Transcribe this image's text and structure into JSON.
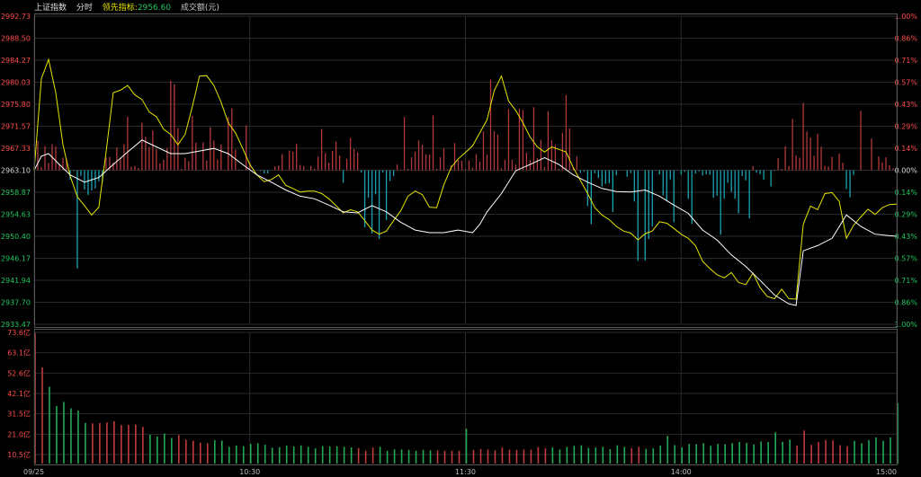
{
  "header": {
    "index_name": "上证指数",
    "mode": "分时",
    "leading_label": "领先指标:",
    "leading_value": "2956.60",
    "volume_label": "成交额(元)"
  },
  "colors": {
    "background": "#000000",
    "grid": "#2a2a2a",
    "frame": "#555555",
    "up": "#ff4d4d",
    "down": "#22c55e",
    "neutral": "#d9d9d9",
    "price_line": "#ffffff",
    "leading_line": "#e6e600",
    "pos_bar": "#b03a3a",
    "neg_bar": "#1ba3b3",
    "vol_up": "#c23b3b",
    "vol_down": "#22aa55",
    "header_text": "#e0e0e0",
    "header_value": "#22c55e"
  },
  "chart_data": [
    {
      "type": "line",
      "panel": "price",
      "preclose": 2963.1,
      "ylim": [
        2933.47,
        2992.73
      ],
      "y_ticks_left": [
        "2992.73",
        "2988.50",
        "2984.27",
        "2980.03",
        "2975.80",
        "2971.57",
        "2967.33",
        "2963.10",
        "2958.87",
        "2954.63",
        "2950.40",
        "2946.17",
        "2941.94",
        "2937.70",
        "2933.47"
      ],
      "y_ticks_right": [
        "1.00%",
        "0.86%",
        "0.71%",
        "0.57%",
        "0.43%",
        "0.29%",
        "0.14%",
        "0.00%",
        "0.14%",
        "0.29%",
        "0.43%",
        "0.57%",
        "0.71%",
        "0.86%",
        "1.00%"
      ],
      "x_ticks": [
        "09/25",
        "10:30",
        "11:30",
        "14:00",
        "15:00"
      ],
      "minutes_total": 240,
      "series": [
        {
          "key": "price",
          "points": [
            [
              0,
              2963.1
            ],
            [
              2,
              2965.8
            ],
            [
              4,
              2966.3
            ],
            [
              7,
              2964.2
            ],
            [
              10,
              2962.2
            ],
            [
              14,
              2960.8
            ],
            [
              18,
              2961.7
            ],
            [
              22,
              2964.2
            ],
            [
              26,
              2966.6
            ],
            [
              30,
              2968.9
            ],
            [
              34,
              2967.6
            ],
            [
              38,
              2966.3
            ],
            [
              42,
              2966.3
            ],
            [
              46,
              2966.8
            ],
            [
              50,
              2967.3
            ],
            [
              54,
              2966.3
            ],
            [
              58,
              2964.2
            ],
            [
              62,
              2962.2
            ],
            [
              66,
              2960.8
            ],
            [
              70,
              2959.3
            ],
            [
              74,
              2958.1
            ],
            [
              78,
              2957.6
            ],
            [
              82,
              2956.4
            ],
            [
              86,
              2955.1
            ],
            [
              90,
              2954.9
            ],
            [
              94,
              2956.3
            ],
            [
              98,
              2955.1
            ],
            [
              102,
              2953.1
            ],
            [
              106,
              2951.6
            ],
            [
              110,
              2951.1
            ],
            [
              114,
              2951.1
            ],
            [
              118,
              2951.6
            ],
            [
              122,
              2951.1
            ],
            [
              124,
              2952.7
            ],
            [
              126,
              2955.1
            ],
            [
              130,
              2958.6
            ],
            [
              134,
              2963.0
            ],
            [
              138,
              2964.2
            ],
            [
              142,
              2965.5
            ],
            [
              146,
              2964.2
            ],
            [
              150,
              2962.2
            ],
            [
              154,
              2960.8
            ],
            [
              158,
              2959.6
            ],
            [
              162,
              2959.0
            ],
            [
              166,
              2958.9
            ],
            [
              170,
              2959.3
            ],
            [
              174,
              2958.1
            ],
            [
              178,
              2956.4
            ],
            [
              182,
              2954.8
            ],
            [
              186,
              2951.6
            ],
            [
              190,
              2949.7
            ],
            [
              194,
              2946.8
            ],
            [
              198,
              2944.6
            ],
            [
              202,
              2941.9
            ],
            [
              206,
              2939.1
            ],
            [
              210,
              2937.4
            ],
            [
              212,
              2937.1
            ],
            [
              214,
              2947.6
            ],
            [
              218,
              2948.6
            ],
            [
              222,
              2950.0
            ],
            [
              226,
              2954.5
            ],
            [
              230,
              2952.3
            ],
            [
              234,
              2950.8
            ],
            [
              238,
              2950.5
            ],
            [
              240,
              2950.4
            ]
          ]
        },
        {
          "key": "leading",
          "points": [
            [
              0,
              2963.1
            ],
            [
              2,
              2980.7
            ],
            [
              4,
              2984.4
            ],
            [
              6,
              2978.0
            ],
            [
              8,
              2968.0
            ],
            [
              10,
              2962.0
            ],
            [
              12,
              2958.0
            ],
            [
              14,
              2956.3
            ],
            [
              16,
              2954.5
            ],
            [
              18,
              2956.0
            ],
            [
              20,
              2966.5
            ],
            [
              22,
              2978.0
            ],
            [
              24,
              2978.5
            ],
            [
              26,
              2979.4
            ],
            [
              28,
              2977.6
            ],
            [
              30,
              2976.7
            ],
            [
              32,
              2974.3
            ],
            [
              34,
              2973.4
            ],
            [
              36,
              2971.0
            ],
            [
              38,
              2970.0
            ],
            [
              40,
              2968.0
            ],
            [
              42,
              2970.0
            ],
            [
              44,
              2975.3
            ],
            [
              46,
              2981.2
            ],
            [
              48,
              2981.3
            ],
            [
              50,
              2979.4
            ],
            [
              52,
              2976.2
            ],
            [
              54,
              2972.2
            ],
            [
              56,
              2970.3
            ],
            [
              58,
              2967.3
            ],
            [
              60,
              2964.2
            ],
            [
              62,
              2962.2
            ],
            [
              64,
              2960.9
            ],
            [
              66,
              2961.3
            ],
            [
              68,
              2962.2
            ],
            [
              70,
              2960.2
            ],
            [
              72,
              2959.6
            ],
            [
              74,
              2958.9
            ],
            [
              76,
              2959.1
            ],
            [
              78,
              2959.1
            ],
            [
              80,
              2958.6
            ],
            [
              82,
              2957.6
            ],
            [
              84,
              2956.3
            ],
            [
              86,
              2954.9
            ],
            [
              88,
              2955.5
            ],
            [
              90,
              2955.1
            ],
            [
              92,
              2953.4
            ],
            [
              94,
              2951.6
            ],
            [
              96,
              2950.8
            ],
            [
              98,
              2951.4
            ],
            [
              100,
              2953.4
            ],
            [
              102,
              2955.3
            ],
            [
              104,
              2958.1
            ],
            [
              106,
              2959.1
            ],
            [
              108,
              2958.4
            ],
            [
              110,
              2956.0
            ],
            [
              112,
              2955.9
            ],
            [
              114,
              2960.3
            ],
            [
              116,
              2963.6
            ],
            [
              118,
              2965.3
            ],
            [
              120,
              2966.5
            ],
            [
              122,
              2967.8
            ],
            [
              124,
              2970.3
            ],
            [
              126,
              2972.8
            ],
            [
              128,
              2978.4
            ],
            [
              130,
              2981.2
            ],
            [
              132,
              2976.4
            ],
            [
              134,
              2974.6
            ],
            [
              136,
              2972.2
            ],
            [
              138,
              2969.5
            ],
            [
              140,
              2967.6
            ],
            [
              142,
              2966.6
            ],
            [
              144,
              2967.6
            ],
            [
              146,
              2967.1
            ],
            [
              148,
              2966.6
            ],
            [
              150,
              2963.6
            ],
            [
              152,
              2961.1
            ],
            [
              154,
              2958.6
            ],
            [
              156,
              2955.9
            ],
            [
              158,
              2954.5
            ],
            [
              160,
              2953.6
            ],
            [
              162,
              2952.3
            ],
            [
              164,
              2951.4
            ],
            [
              166,
              2951.0
            ],
            [
              168,
              2949.7
            ],
            [
              170,
              2950.9
            ],
            [
              172,
              2951.4
            ],
            [
              174,
              2953.2
            ],
            [
              176,
              2952.9
            ],
            [
              178,
              2951.9
            ],
            [
              180,
              2950.8
            ],
            [
              182,
              2950.0
            ],
            [
              184,
              2948.6
            ],
            [
              186,
              2945.6
            ],
            [
              188,
              2944.2
            ],
            [
              190,
              2943.0
            ],
            [
              192,
              2942.4
            ],
            [
              194,
              2943.4
            ],
            [
              196,
              2941.5
            ],
            [
              198,
              2941.1
            ],
            [
              200,
              2943.3
            ],
            [
              202,
              2940.5
            ],
            [
              204,
              2938.8
            ],
            [
              206,
              2938.4
            ],
            [
              208,
              2940.2
            ],
            [
              210,
              2938.4
            ],
            [
              212,
              2938.3
            ],
            [
              214,
              2952.7
            ],
            [
              216,
              2956.2
            ],
            [
              218,
              2955.5
            ],
            [
              220,
              2958.6
            ],
            [
              222,
              2958.8
            ],
            [
              224,
              2957.1
            ],
            [
              226,
              2950.0
            ],
            [
              228,
              2952.5
            ],
            [
              230,
              2954.1
            ],
            [
              232,
              2955.6
            ],
            [
              234,
              2954.6
            ],
            [
              236,
              2955.9
            ],
            [
              238,
              2956.5
            ],
            [
              240,
              2956.6
            ]
          ]
        }
      ]
    },
    {
      "type": "bar",
      "panel": "volume",
      "ylim": [
        0,
        73.6
      ],
      "y_ticks": [
        "73.6亿",
        "63.1亿",
        "52.6亿",
        "42.1亿",
        "31.5亿",
        "21.0亿",
        "10.5亿"
      ],
      "anchors": [
        [
          0,
          73
        ],
        [
          3,
          40
        ],
        [
          5,
          36
        ],
        [
          8,
          31
        ],
        [
          12,
          28
        ],
        [
          18,
          24
        ],
        [
          26,
          20
        ],
        [
          36,
          16
        ],
        [
          48,
          12
        ],
        [
          60,
          10
        ],
        [
          80,
          9
        ],
        [
          100,
          8
        ],
        [
          120,
          8
        ],
        [
          140,
          9
        ],
        [
          160,
          9
        ],
        [
          180,
          10
        ],
        [
          200,
          11
        ],
        [
          215,
          12
        ],
        [
          225,
          11
        ],
        [
          234,
          13
        ],
        [
          238,
          16
        ],
        [
          239,
          21
        ],
        [
          240,
          31
        ]
      ],
      "spikes": [
        [
          120,
          19.5
        ],
        [
          176,
          15.5
        ],
        [
          206,
          17.5
        ],
        [
          214,
          18.5
        ]
      ]
    }
  ]
}
